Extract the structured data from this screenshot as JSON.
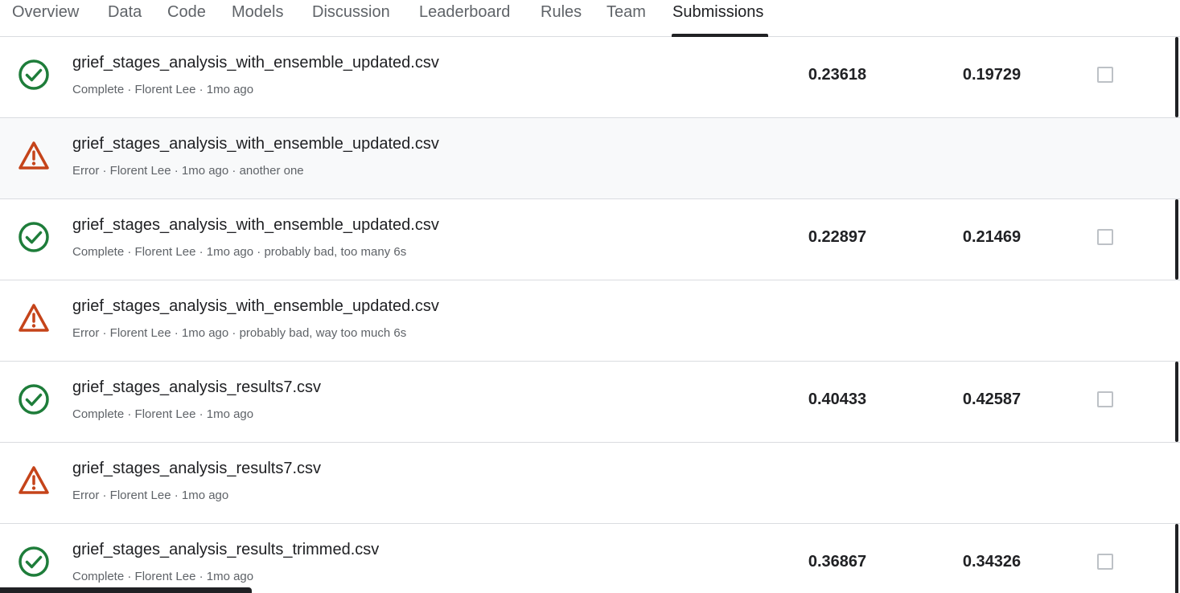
{
  "tabs": [
    {
      "label": "Overview"
    },
    {
      "label": "Data"
    },
    {
      "label": "Code"
    },
    {
      "label": "Models"
    },
    {
      "label": "Discussion"
    },
    {
      "label": "Leaderboard"
    },
    {
      "label": "Rules"
    },
    {
      "label": "Team"
    },
    {
      "label": "Submissions",
      "active": true
    }
  ],
  "colors": {
    "success": "#1e7d3a",
    "error": "#c5441a",
    "text": "#202124",
    "muted": "#5f6368"
  },
  "submissions": [
    {
      "status": "complete",
      "icon": "check-circle-icon",
      "filename": "grief_stages_analysis_with_ensemble_updated.csv",
      "meta": "Complete · Florent Lee · 1mo ago",
      "public_score": "0.23618",
      "private_score": "0.19729",
      "selected": false
    },
    {
      "status": "error",
      "icon": "warning-triangle-icon",
      "filename": "grief_stages_analysis_with_ensemble_updated.csv",
      "meta": "Error · Florent Lee · 1mo ago · another one"
    },
    {
      "status": "complete",
      "icon": "check-circle-icon",
      "filename": "grief_stages_analysis_with_ensemble_updated.csv",
      "meta": "Complete · Florent Lee · 1mo ago · probably bad, too many 6s",
      "public_score": "0.22897",
      "private_score": "0.21469",
      "selected": false
    },
    {
      "status": "error",
      "icon": "warning-triangle-icon",
      "filename": "grief_stages_analysis_with_ensemble_updated.csv",
      "meta": "Error · Florent Lee · 1mo ago · probably bad, way too much 6s"
    },
    {
      "status": "complete",
      "icon": "check-circle-icon",
      "filename": "grief_stages_analysis_results7.csv",
      "meta": "Complete · Florent Lee · 1mo ago",
      "public_score": "0.40433",
      "private_score": "0.42587",
      "selected": false
    },
    {
      "status": "error",
      "icon": "warning-triangle-icon",
      "filename": "grief_stages_analysis_results7.csv",
      "meta": "Error · Florent Lee · 1mo ago"
    },
    {
      "status": "complete",
      "icon": "check-circle-icon",
      "filename": "grief_stages_analysis_results_trimmed.csv",
      "meta": "Complete · Florent Lee · 1mo ago",
      "public_score": "0.36867",
      "private_score": "0.34326",
      "selected": false
    }
  ]
}
